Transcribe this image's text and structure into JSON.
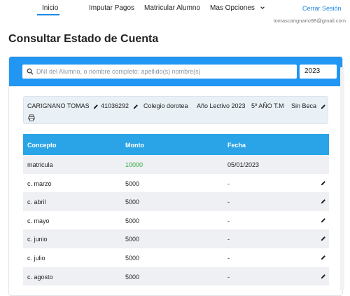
{
  "nav": {
    "items": [
      {
        "label": "Inicio",
        "active": true
      },
      {
        "label": "Imputar Pagos"
      },
      {
        "label": "Matricular Alumno"
      },
      {
        "label": "Mas Opciones"
      }
    ],
    "logout_label": "Cerrar Sesión",
    "user_email": "tomascangnario98@gmail.com"
  },
  "page": {
    "title": "Consultar Estado de Cuenta"
  },
  "search": {
    "placeholder": "DNI del Alumno, o nombre completo: apellido(s) nombre(s)",
    "value": "",
    "year": "2023"
  },
  "student": {
    "name": "CARIGNANO TOMAS",
    "dni": "41036292",
    "school": "Colegio dorotea",
    "year_label": "Año Lectivo 2023",
    "grade": "5º AÑO T.M",
    "scholarship": "Sin Beca"
  },
  "table": {
    "headers": [
      "Concepto",
      "Monto",
      "Fecha"
    ],
    "rows": [
      {
        "concepto": "matricula",
        "monto": "10000",
        "fecha": "05/01/2023",
        "paid": true
      },
      {
        "concepto": "c. marzo",
        "monto": "5000",
        "fecha": "-"
      },
      {
        "concepto": "c. abril",
        "monto": "5000",
        "fecha": "-"
      },
      {
        "concepto": "c. mayo",
        "monto": "5000",
        "fecha": "-"
      },
      {
        "concepto": "c. junio",
        "monto": "5000",
        "fecha": "-"
      },
      {
        "concepto": "c. julio",
        "monto": "5000",
        "fecha": "-"
      },
      {
        "concepto": "c. agosto",
        "monto": "5000",
        "fecha": "-"
      }
    ]
  },
  "colors": {
    "accent": "#2196f3",
    "table_header": "#2aa4e6",
    "paid_amount": "#2eaa3e",
    "info_bg": "#e9f1f7"
  },
  "icons": [
    "chevron-down-icon",
    "search-icon",
    "pencil-icon",
    "printer-icon"
  ]
}
